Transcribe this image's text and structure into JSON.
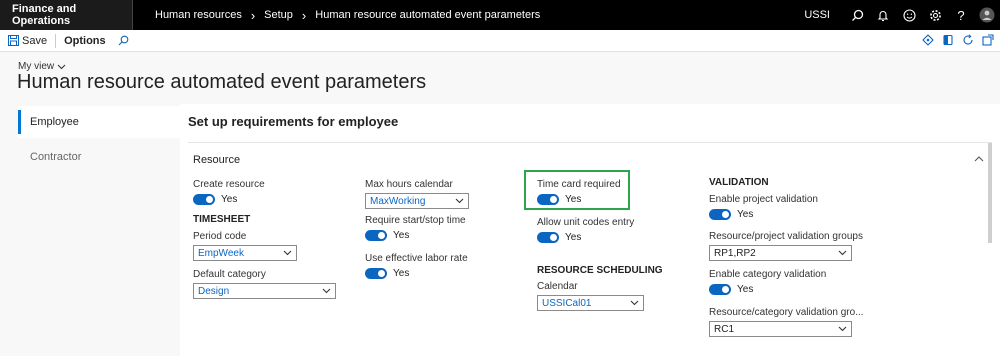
{
  "nav": {
    "app_name": "Finance and Operations",
    "breadcrumbs": [
      "Human resources",
      "Setup",
      "Human resource automated event parameters"
    ],
    "company": "USSI"
  },
  "toolbar": {
    "save_label": "Save",
    "options_label": "Options"
  },
  "header": {
    "view_label": "My view",
    "page_title": "Human resource automated event parameters"
  },
  "tabs": {
    "employee": "Employee",
    "contractor": "Contractor"
  },
  "main": {
    "section_title": "Set up requirements for employee",
    "fasttab_title": "Resource"
  },
  "fields": {
    "create_resource": {
      "label": "Create resource",
      "value": "Yes"
    },
    "timesheet_head": "TIMESHEET",
    "period_code": {
      "label": "Period code",
      "value": "EmpWeek"
    },
    "default_category": {
      "label": "Default category",
      "value": "Design"
    },
    "max_hours_calendar": {
      "label": "Max hours calendar",
      "value": "MaxWorking"
    },
    "require_start_stop": {
      "label": "Require start/stop time",
      "value": "Yes"
    },
    "use_effective_labor": {
      "label": "Use effective labor rate",
      "value": "Yes"
    },
    "time_card_required": {
      "label": "Time card required",
      "value": "Yes"
    },
    "allow_unit_codes": {
      "label": "Allow unit codes entry",
      "value": "Yes"
    },
    "resource_scheduling_head": "RESOURCE SCHEDULING",
    "calendar": {
      "label": "Calendar",
      "value": "USSICal01"
    },
    "validation_head": "VALIDATION",
    "enable_project_validation": {
      "label": "Enable project validation",
      "value": "Yes"
    },
    "resource_project_groups": {
      "label": "Resource/project validation groups",
      "value": "RP1,RP2"
    },
    "enable_category_validation": {
      "label": "Enable category validation",
      "value": "Yes"
    },
    "resource_category_groups": {
      "label": "Resource/category validation gro...",
      "value": "RC1"
    }
  },
  "colors": {
    "accent": "#0b66c2",
    "highlight": "#2ea44f",
    "topbar": "#000000"
  }
}
